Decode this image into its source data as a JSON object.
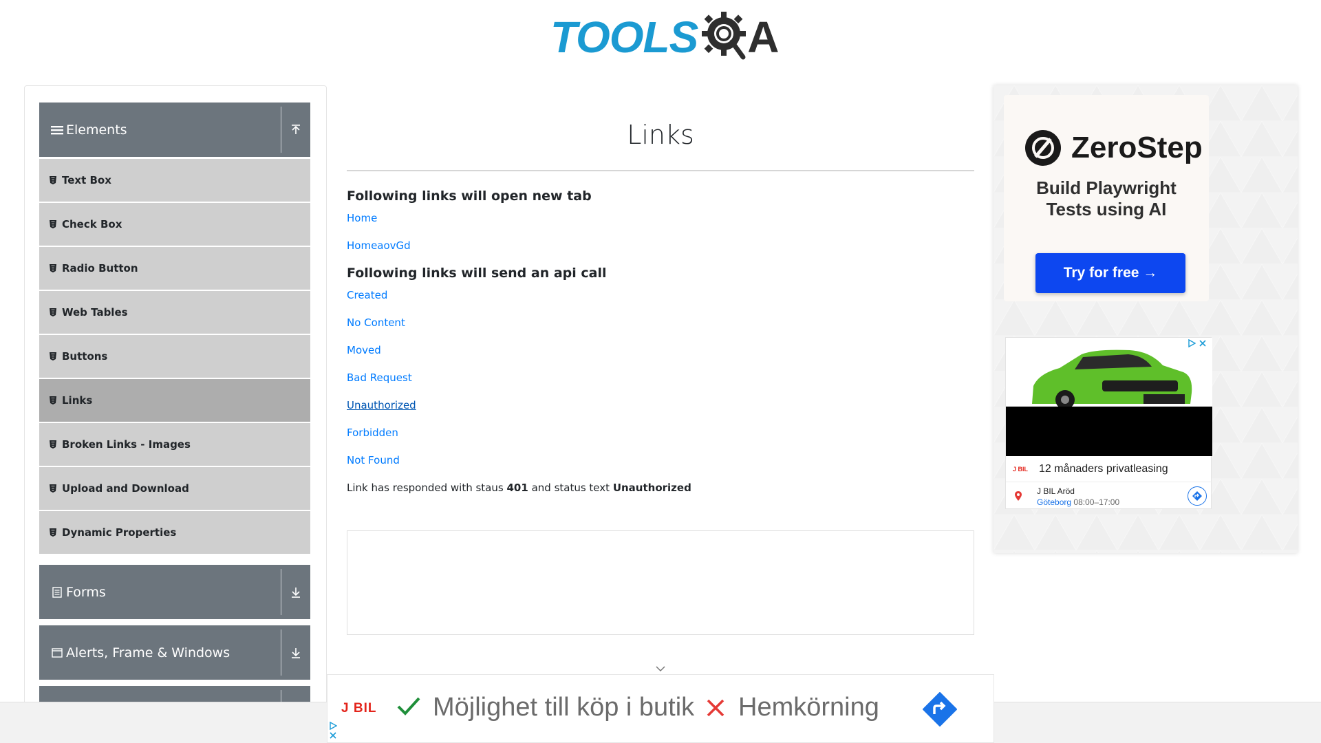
{
  "header": {
    "logo_tools": "TOOLS",
    "logo_a": "A"
  },
  "sidebar": {
    "groups": [
      {
        "label": "Elements",
        "icon": "menu-icon",
        "state": "expanded"
      },
      {
        "label": "Forms",
        "icon": "form-icon",
        "state": "collapsed"
      },
      {
        "label": "Alerts, Frame & Windows",
        "icon": "window-icon",
        "state": "collapsed"
      }
    ],
    "items": [
      {
        "label": "Text Box"
      },
      {
        "label": "Check Box"
      },
      {
        "label": "Radio Button"
      },
      {
        "label": "Web Tables"
      },
      {
        "label": "Buttons"
      },
      {
        "label": "Links",
        "active": true
      },
      {
        "label": "Broken Links - Images"
      },
      {
        "label": "Upload and Download"
      },
      {
        "label": "Dynamic Properties"
      }
    ]
  },
  "main": {
    "title": "Links",
    "section_new_tab": "Following links will open new tab",
    "new_tab_links": [
      "Home",
      "HomeaovGd"
    ],
    "section_api": "Following links will send an api call",
    "api_links": [
      "Created",
      "No Content",
      "Moved",
      "Bad Request",
      "Unauthorized",
      "Forbidden",
      "Not Found"
    ],
    "response": {
      "prefix": "Link has responded with staus",
      "status_code": "401",
      "middle": "and status text",
      "status_text": "Unauthorized"
    }
  },
  "ad_right": {
    "brand": "ZeroStep",
    "tagline_line1": "Build Playwright",
    "tagline_line2": "Tests using AI",
    "cta": "Try for free →",
    "car_brand": "J BIL",
    "car_offer": "12 månaders privatleasing",
    "dealer": "J BIL Aröd",
    "dealer_city": "Göteborg",
    "dealer_hours": "08:00–17:00"
  },
  "ad_bottom": {
    "brand": "J BIL",
    "option_yes": "Möjlighet till köp i butik",
    "option_no": "Hemkörning"
  },
  "colors": {
    "brand_blue": "#1b9ad2",
    "group_header": "#6c757d",
    "menu_item": "#cfcfcf",
    "menu_item_active": "#adadad",
    "link": "#007bff",
    "cta_blue": "#0d47f0",
    "jbil_red": "#e3241b"
  }
}
